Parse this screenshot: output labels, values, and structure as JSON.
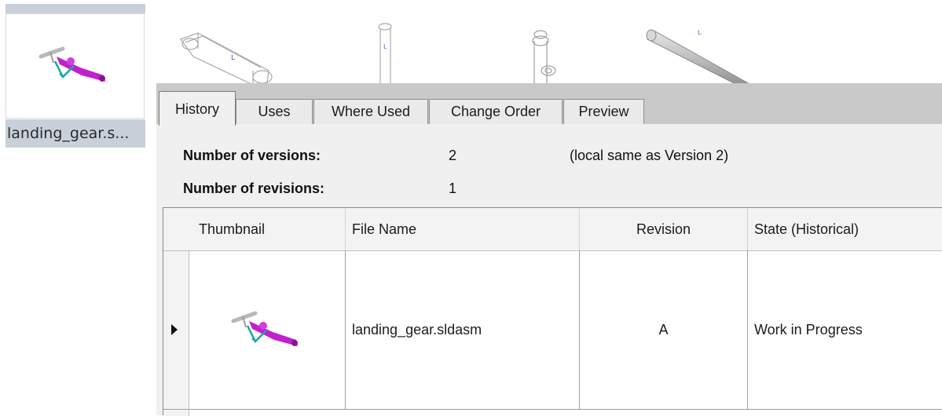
{
  "file_tile": {
    "label": "landing_gear.s...",
    "thumbnail_icon": "landing-gear-assembly-icon"
  },
  "background_parts": [
    "linkage-arm-part-icon",
    "pin-part-icon",
    "bushing-part-icon",
    "rod-part-icon"
  ],
  "tabs": [
    {
      "label": "History",
      "active": true
    },
    {
      "label": "Uses",
      "active": false
    },
    {
      "label": "Where Used",
      "active": false
    },
    {
      "label": "Change Order",
      "active": false
    },
    {
      "label": "Preview",
      "active": false
    }
  ],
  "info": {
    "versions_label": "Number of versions:",
    "versions_value": "2",
    "versions_note": "(local same as Version 2)",
    "revisions_label": "Number of revisions:",
    "revisions_value": "1"
  },
  "table": {
    "columns": [
      "Thumbnail",
      "File Name",
      "Revision",
      "State (Historical)"
    ],
    "rows": [
      {
        "thumbnail_icon": "landing-gear-assembly-icon",
        "file_name": "landing_gear.sldasm",
        "revision": "A",
        "state": "Work in Progress"
      }
    ]
  },
  "colors": {
    "selection_gray": "#c9d0d9",
    "tabstrip_gray": "#c9c9c9",
    "panel_bg": "#f0f0f0",
    "assembly_magenta": "#c21fcf",
    "assembly_teal": "#1aa6a6"
  }
}
